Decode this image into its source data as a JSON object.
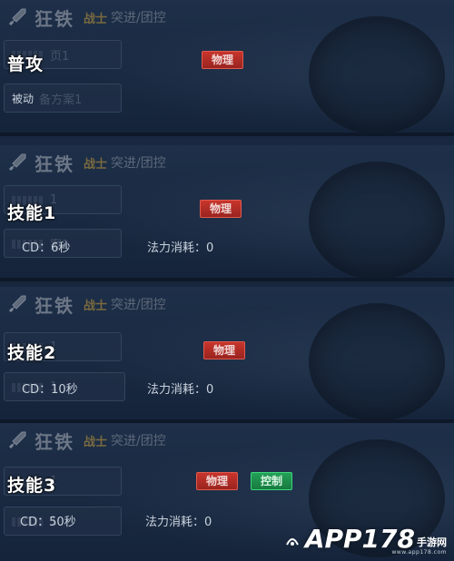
{
  "hero": {
    "name": "狂铁",
    "class": "战士",
    "role": "突进/团控"
  },
  "panels": [
    {
      "skill": "普攻",
      "ghost_top": "页1",
      "ghost_bottom_prefix": "被动",
      "ghost_bottom": "备方案1",
      "tags": [
        "物理"
      ],
      "cd": "",
      "mana": ""
    },
    {
      "skill": "技能1",
      "ghost_top": "1",
      "ghost_bottom_prefix": "",
      "ghost_bottom": "案1",
      "tags": [
        "物理"
      ],
      "cd": "CD：6秒",
      "mana": "法力消耗：0"
    },
    {
      "skill": "技能2",
      "ghost_top": "1",
      "ghost_bottom_prefix": "",
      "ghost_bottom": "1",
      "tags": [
        "物理"
      ],
      "cd": "CD：10秒",
      "mana": "法力消耗：0"
    },
    {
      "skill": "技能3",
      "ghost_top": "1",
      "ghost_bottom_prefix": "",
      "ghost_bottom": "1",
      "tags": [
        "物理",
        "控制"
      ],
      "cd": "CD：50秒",
      "mana": "法力消耗：0"
    }
  ],
  "watermark": {
    "brand": "APP178",
    "sub": "手游网",
    "url": "www.app178.com"
  },
  "colors": {
    "physical_tag": "#c7352c",
    "control_tag": "#24a057",
    "class_text": "#7a6a3e"
  }
}
